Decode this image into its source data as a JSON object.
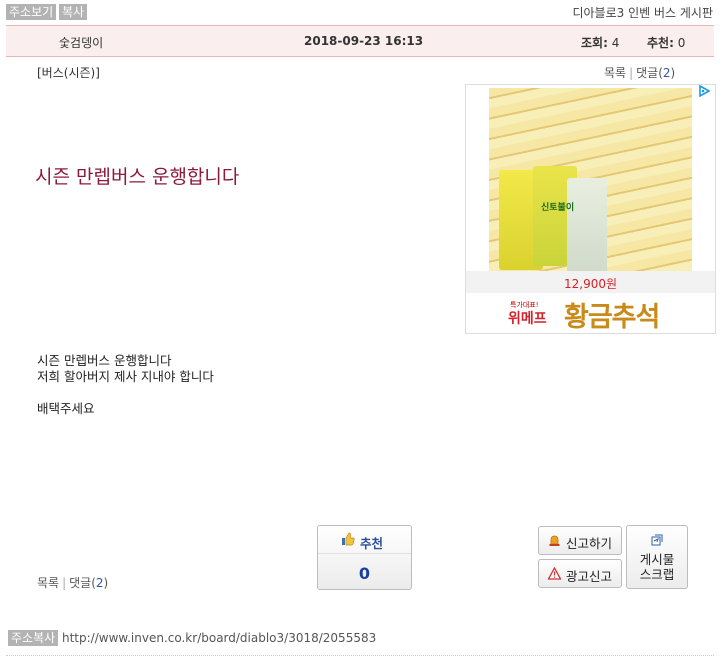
{
  "topbar": {
    "address_view": "주소보기",
    "copy": "복사",
    "board_name": "디아블로3 인벤 버스 게시판"
  },
  "info": {
    "author": "숯검뎅이",
    "datetime": "2018-09-23 16:13",
    "views_label": "조회:",
    "views": "4",
    "recommend_label": "추천:",
    "recommend": "0"
  },
  "category": "[버스(시즌)]",
  "links": {
    "list": "목록",
    "separator": "|",
    "comments_label": "댓글(",
    "comments_count": "2",
    "comments_close": ")"
  },
  "post": {
    "title": "시즌 만렙버스 운행합니다",
    "body": [
      "시즌 만렙버스 운행합니다",
      "저희 할아버지 제사 지내야 합니다",
      "",
      "배택주세요"
    ]
  },
  "ad": {
    "price": "12,900원",
    "brand_small": "특가대표!",
    "brand": "위메프",
    "slogan": "황금추석",
    "bag_label": "신토불이"
  },
  "buttons": {
    "recommend_label": "추천",
    "recommend_count": "0",
    "report": "신고하기",
    "ad_report": "광고신고",
    "scrap_line1": "게시물",
    "scrap_line2": "스크랩"
  },
  "footer": {
    "address_copy": "주소복사",
    "url": "http://www.inven.co.kr/board/diablo3/3018/2055583"
  },
  "icons": {
    "thumbs_up": "thumbs-up-icon",
    "siren": "siren-icon",
    "warning": "warning-icon",
    "scrap": "scrap-icon",
    "adchoices": "adchoices-icon"
  },
  "colors": {
    "title": "#8b1a3c",
    "info_bar_bg": "#fbeeee",
    "recommend_blue": "#1a3fa0",
    "price_red": "#d2232a"
  }
}
